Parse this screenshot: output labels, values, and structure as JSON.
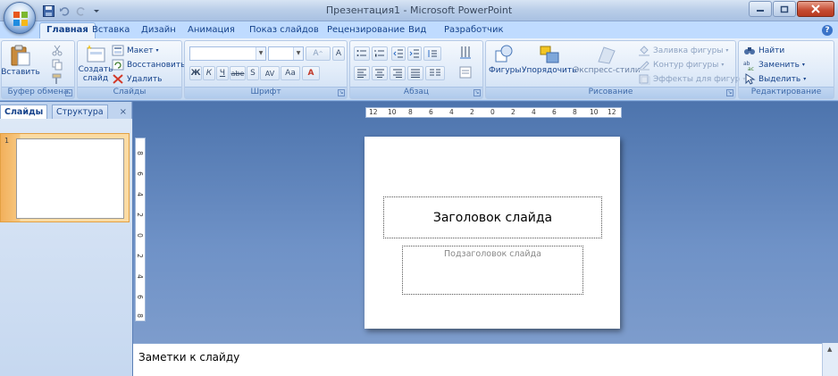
{
  "window": {
    "title": "Презентация1 - Microsoft PowerPoint"
  },
  "tabs": [
    "Главная",
    "Вставка",
    "Дизайн",
    "Анимация",
    "Показ слайдов",
    "Рецензирование",
    "Вид",
    "Разработчик"
  ],
  "ribbon": {
    "clipboard": {
      "paste": "Вставить",
      "label": "Буфер обмена"
    },
    "slides": {
      "create": "Создать",
      "create2": "слайд",
      "layout": "Макет",
      "reset": "Восстановить",
      "delete": "Удалить",
      "label": "Слайды"
    },
    "font": {
      "bold": "Ж",
      "italic": "К",
      "underline": "Ч",
      "strike": "abe",
      "shadow": "S",
      "spacing": "AV",
      "case": "Aa",
      "grow": "A",
      "shrink": "A",
      "clear": "A",
      "label": "Шрифт"
    },
    "paragraph": {
      "label": "Абзац"
    },
    "drawing": {
      "shapes": "Фигуры",
      "arrange": "Упорядочить",
      "styles": "Экспресс-стили",
      "fill": "Заливка фигуры",
      "outline": "Контур фигуры",
      "effects": "Эффекты для фигур",
      "label": "Рисование"
    },
    "editing": {
      "find": "Найти",
      "replace": "Заменить",
      "select": "Выделить",
      "label": "Редактирование"
    }
  },
  "leftpane": {
    "tab_slides": "Слайды",
    "tab_outline": "Структура",
    "close": "×",
    "slide_number": "1"
  },
  "ruler": {
    "h_ticks": [
      "12",
      "10",
      "8",
      "6",
      "4",
      "2",
      "0",
      "2",
      "4",
      "6",
      "8",
      "10",
      "12"
    ],
    "v_ticks": [
      "8",
      "6",
      "4",
      "2",
      "0",
      "2",
      "4",
      "6",
      "8"
    ]
  },
  "slide": {
    "title_placeholder": "Заголовок слайда",
    "subtitle_placeholder": "Подзаголовок слайда"
  },
  "notes": {
    "placeholder": "Заметки к слайду"
  }
}
